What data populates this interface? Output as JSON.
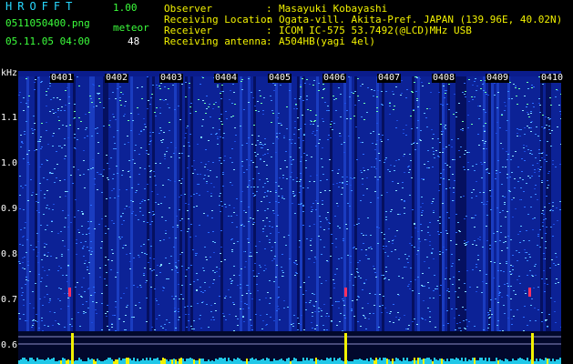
{
  "app": {
    "name": "HROFFT",
    "version": "1.00",
    "mode": "meteor"
  },
  "file": {
    "name": "0511050400.png",
    "datetime": "05.11.05 04:00",
    "count": "48"
  },
  "info": [
    {
      "label": "Observer",
      "colon": ":",
      "value": "Masayuki Kobayashi"
    },
    {
      "label": "Receiving Location",
      "colon": ":",
      "value": "Ogata-vill. Akita-Pref. JAPAN (139.96E, 40.02N)"
    },
    {
      "label": "Receiver",
      "colon": ":",
      "value": "ICOM IC-575 53.7492(@LCD)MHz USB"
    },
    {
      "label": "Receiving antenna",
      "colon": ":",
      "value": "A504HB(yagi 4el)"
    }
  ],
  "axis": {
    "unit": "kHz",
    "y_ticks": [
      "1.1",
      "1.0",
      "0.9",
      "0.8",
      "0.7",
      "0.6"
    ],
    "time_ticks": [
      "0401",
      "0402",
      "0403",
      "0404",
      "0405",
      "0406",
      "0407",
      "0408",
      "0409",
      "0410"
    ]
  },
  "colors": {
    "accent": "#28d8ff",
    "text": "#f2f200",
    "value": "#3cff3c",
    "background": "#000000"
  }
}
